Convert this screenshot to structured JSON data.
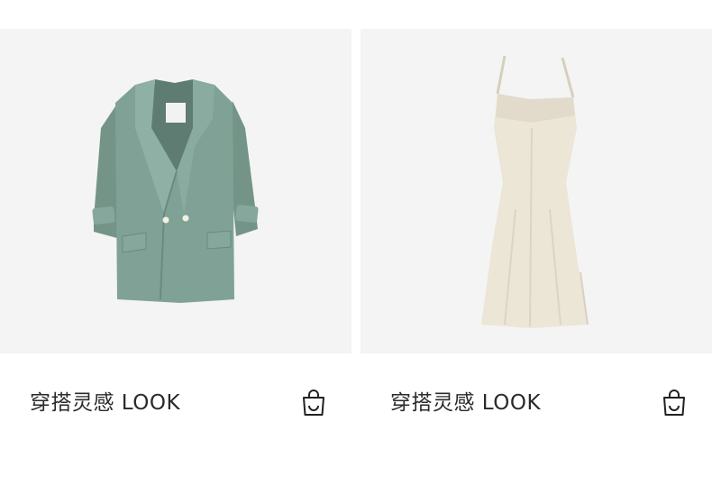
{
  "products": [
    {
      "title": "穿搭灵感 LOOK",
      "image": "sage-green-double-breasted-blazer",
      "color": "#7f9f96",
      "icon": "shopping-bag-icon"
    },
    {
      "title": "穿搭灵感 LOOK",
      "image": "cream-slip-dress",
      "color": "#ece6d7",
      "icon": "shopping-bag-icon"
    }
  ]
}
